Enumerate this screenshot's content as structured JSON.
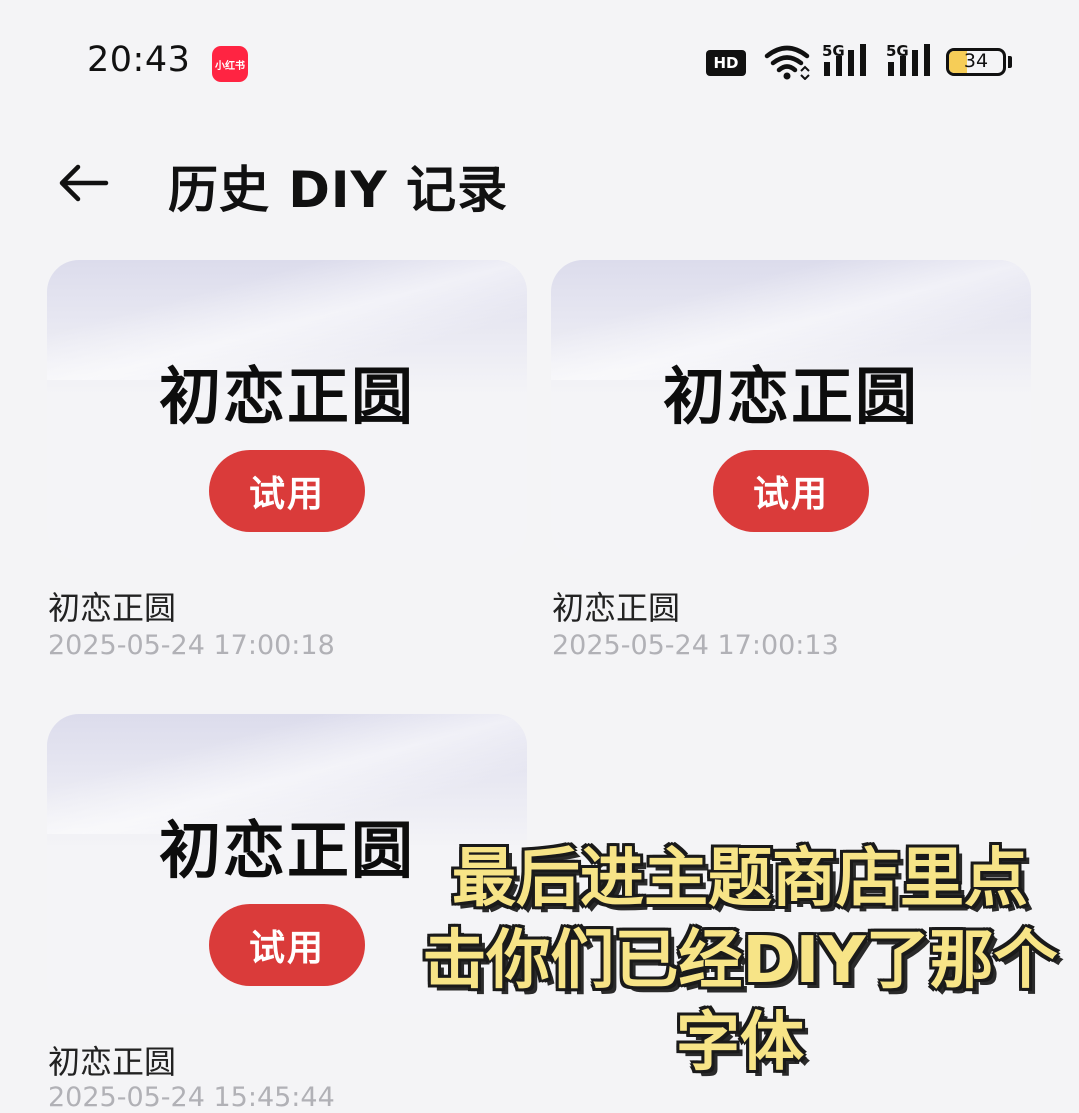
{
  "status_bar": {
    "time": "20:43",
    "app_badge": "小红书",
    "hd_label": "HD",
    "network_1": "5G",
    "network_2": "5G",
    "battery_percent": "34",
    "battery_level": 0.34,
    "battery_color": "#f6cd57",
    "icons": [
      "hd-voice-icon",
      "wifi-icon",
      "signal-5g-icon",
      "signal-5g-icon",
      "battery-icon"
    ]
  },
  "header": {
    "back_icon": "arrow-left-icon",
    "title": "历史 DIY 记录"
  },
  "records": [
    {
      "preview_text": "初恋正圆",
      "try_label": "试用",
      "name": "初恋正圆",
      "timestamp": "2025-05-24 17:00:18"
    },
    {
      "preview_text": "初恋正圆",
      "try_label": "试用",
      "name": "初恋正圆",
      "timestamp": "2025-05-24 17:00:13"
    },
    {
      "preview_text": "初恋正圆",
      "try_label": "试用",
      "name": "初恋正圆",
      "timestamp": "2025-05-24 15:45:44"
    }
  ],
  "overlay_caption": {
    "line1": "最后进主题商店里点",
    "line2": "击你们已经DIY了那个",
    "line3": "字体"
  },
  "colors": {
    "accent_button": "#da3b3a",
    "caption_text": "#f7e487",
    "timestamp_text": "#b1b1b6"
  }
}
